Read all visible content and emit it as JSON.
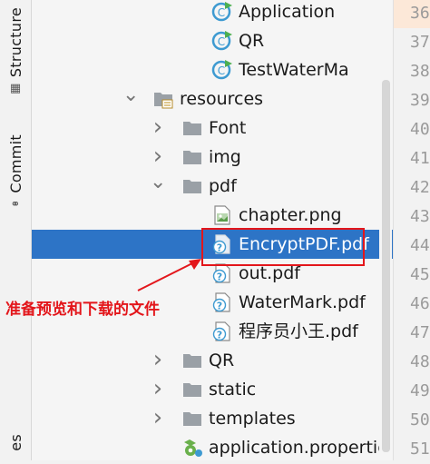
{
  "sidebar": {
    "structure_label": "Structure",
    "commit_label": "Commit",
    "bottom_label": "es"
  },
  "tree": {
    "items": [
      {
        "label": "Application",
        "type": "java-class"
      },
      {
        "label": "QR",
        "type": "java-class"
      },
      {
        "label": "TestWaterMa",
        "type": "java-class"
      },
      {
        "label": "resources",
        "type": "resources-folder",
        "expanded": true
      },
      {
        "label": "Font",
        "type": "folder",
        "expanded": false
      },
      {
        "label": "img",
        "type": "folder",
        "expanded": false
      },
      {
        "label": "pdf",
        "type": "folder",
        "expanded": true
      },
      {
        "label": "chapter.png",
        "type": "image-file"
      },
      {
        "label": "EncryptPDF.pdf",
        "type": "unknown-file",
        "selected": true
      },
      {
        "label": "out.pdf",
        "type": "unknown-file"
      },
      {
        "label": "WaterMark.pdf",
        "type": "unknown-file"
      },
      {
        "label": "程序员小王.pdf",
        "type": "unknown-file"
      },
      {
        "label": "QR",
        "type": "folder",
        "expanded": false
      },
      {
        "label": "static",
        "type": "folder",
        "expanded": false
      },
      {
        "label": "templates",
        "type": "folder",
        "expanded": false
      },
      {
        "label": "application.propertie",
        "type": "properties-file"
      }
    ]
  },
  "gutter": {
    "lines": [
      "36",
      "37",
      "38",
      "39",
      "40",
      "41",
      "42",
      "43",
      "44",
      "45",
      "46",
      "47",
      "48",
      "49",
      "50",
      "51"
    ],
    "current_index": 0
  },
  "annotation": {
    "text": "准备预览和下载的文件",
    "color": "#e3161b"
  },
  "colors": {
    "selection": "#2d74c6",
    "folder": "#9aa0a6",
    "class_icon": "#3d9ad1",
    "run_badge": "#4caf50"
  }
}
